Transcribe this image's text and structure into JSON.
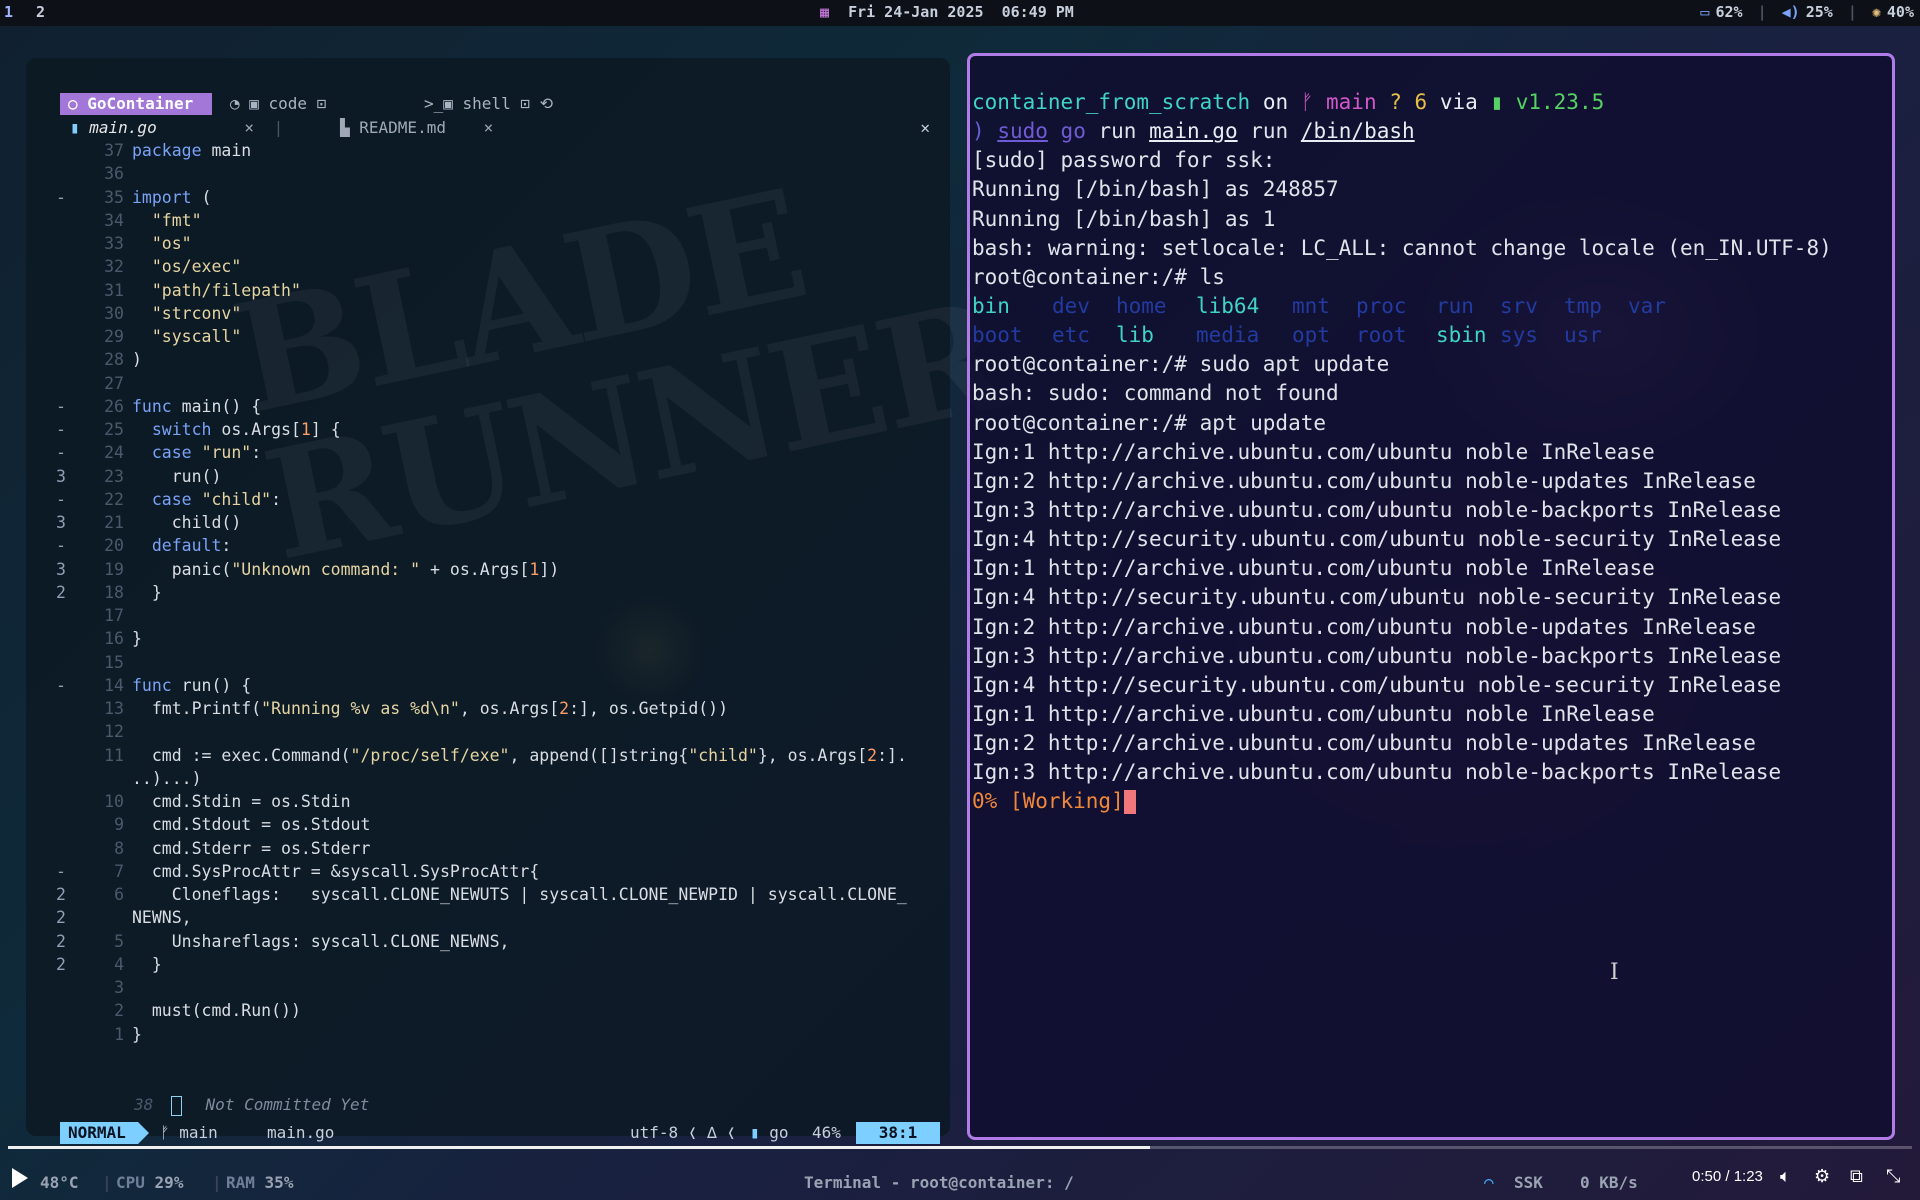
{
  "topbar": {
    "workspace_active": "1",
    "workspace_other": "2",
    "datetime": "Fri 24-Jan 2025  06:49 PM",
    "battery": "62%",
    "volume": "25%",
    "brightness": "40%"
  },
  "editor": {
    "wallpaper_text_1": "BLADE",
    "wallpaper_text_2": "RUNNER",
    "tabs": {
      "active": "GoContainer",
      "code": "code",
      "shell": "shell"
    },
    "buffers": {
      "main": "main.go",
      "readme": "README.md"
    },
    "lines": [
      {
        "sign": "",
        "num": "37",
        "text": "package main"
      },
      {
        "sign": "",
        "num": "36",
        "text": ""
      },
      {
        "sign": "-",
        "num": "35",
        "text": "import ("
      },
      {
        "sign": "",
        "num": "34",
        "text": "  \"fmt\""
      },
      {
        "sign": "",
        "num": "33",
        "text": "  \"os\""
      },
      {
        "sign": "",
        "num": "32",
        "text": "  \"os/exec\""
      },
      {
        "sign": "",
        "num": "31",
        "text": "  \"path/filepath\""
      },
      {
        "sign": "",
        "num": "30",
        "text": "  \"strconv\""
      },
      {
        "sign": "",
        "num": "29",
        "text": "  \"syscall\""
      },
      {
        "sign": "",
        "num": "28",
        "text": ")"
      },
      {
        "sign": "",
        "num": "27",
        "text": ""
      },
      {
        "sign": "-",
        "num": "26",
        "text": "func main() {"
      },
      {
        "sign": "-",
        "num": "25",
        "text": "  switch os.Args[1] {"
      },
      {
        "sign": "-",
        "num": "24",
        "text": "  case \"run\":"
      },
      {
        "sign": "3",
        "num": "23",
        "text": "    run()"
      },
      {
        "sign": "-",
        "num": "22",
        "text": "  case \"child\":"
      },
      {
        "sign": "3",
        "num": "21",
        "text": "    child()"
      },
      {
        "sign": "-",
        "num": "20",
        "text": "  default:"
      },
      {
        "sign": "3",
        "num": "19",
        "text": "    panic(\"Unknown command: \" + os.Args[1])"
      },
      {
        "sign": "2",
        "num": "18",
        "text": "  }"
      },
      {
        "sign": "",
        "num": "17",
        "text": ""
      },
      {
        "sign": "",
        "num": "16",
        "text": "}"
      },
      {
        "sign": "",
        "num": "15",
        "text": ""
      },
      {
        "sign": "-",
        "num": "14",
        "text": "func run() {"
      },
      {
        "sign": "",
        "num": "13",
        "text": "  fmt.Printf(\"Running %v as %d\\n\", os.Args[2:], os.Getpid())"
      },
      {
        "sign": "",
        "num": "12",
        "text": ""
      },
      {
        "sign": "",
        "num": "11",
        "text": "  cmd := exec.Command(\"/proc/self/exe\", append([]string{\"child\"}, os.Args[2:]."
      },
      {
        "sign": "",
        "num": "",
        "text": "..)...)"
      },
      {
        "sign": "",
        "num": "10",
        "text": "  cmd.Stdin = os.Stdin"
      },
      {
        "sign": "",
        "num": "9",
        "text": "  cmd.Stdout = os.Stdout"
      },
      {
        "sign": "",
        "num": "8",
        "text": "  cmd.Stderr = os.Stderr"
      },
      {
        "sign": "-",
        "num": "7",
        "text": "  cmd.SysProcAttr = &syscall.SysProcAttr{"
      },
      {
        "sign": "2",
        "num": "6",
        "text": "    Cloneflags:   syscall.CLONE_NEWUTS | syscall.CLONE_NEWPID | syscall.CLONE_"
      },
      {
        "sign": "2",
        "num": "",
        "text": "NEWNS,"
      },
      {
        "sign": "2",
        "num": "5",
        "text": "    Unshareflags: syscall.CLONE_NEWNS,"
      },
      {
        "sign": "2",
        "num": "4",
        "text": "  }"
      },
      {
        "sign": "",
        "num": "3",
        "text": ""
      },
      {
        "sign": "",
        "num": "2",
        "text": "  must(cmd.Run())"
      },
      {
        "sign": "",
        "num": "1",
        "text": "}"
      }
    ],
    "blame_num": "38",
    "blame_text": "Not Committed Yet",
    "status": {
      "mode": "NORMAL",
      "branch": "main",
      "file": "main.go",
      "encoding": "utf-8",
      "filetype": "go",
      "percent": "46%",
      "position": "38:1"
    }
  },
  "terminal": {
    "prompt": {
      "dir": "container_from_scratch",
      "on": "on",
      "branch": "main",
      "status": "? 6",
      "via": "via",
      "version": "v1.23.5"
    },
    "command": {
      "arrow": ")",
      "sudo": "sudo",
      "go": "go",
      "run": "run",
      "file": "main.go",
      "run2": "run",
      "arg": "/bin/bash"
    },
    "output_lines": [
      "[sudo] password for ssk:",
      "Running [/bin/bash] as 248857",
      "Running [/bin/bash] as 1",
      "bash: warning: setlocale: LC_ALL: cannot change locale (en_IN.UTF-8)",
      "root@container:/# ls"
    ],
    "ls_row1": [
      "bin",
      "dev",
      "home",
      "lib64",
      "mnt",
      "proc",
      "run",
      "srv",
      "tmp",
      "var"
    ],
    "ls_row2": [
      "boot",
      "etc",
      "lib",
      "media",
      "opt",
      "root",
      "sbin",
      "sys",
      "usr"
    ],
    "after_ls": [
      "root@container:/# sudo apt update",
      "bash: sudo: command not found",
      "root@container:/# apt update",
      "Ign:1 http://archive.ubuntu.com/ubuntu noble InRelease",
      "Ign:2 http://archive.ubuntu.com/ubuntu noble-updates InRelease",
      "Ign:3 http://archive.ubuntu.com/ubuntu noble-backports InRelease",
      "Ign:4 http://security.ubuntu.com/ubuntu noble-security InRelease",
      "Ign:1 http://archive.ubuntu.com/ubuntu noble InRelease",
      "Ign:4 http://security.ubuntu.com/ubuntu noble-security InRelease",
      "Ign:2 http://archive.ubuntu.com/ubuntu noble-updates InRelease",
      "Ign:3 http://archive.ubuntu.com/ubuntu noble-backports InRelease",
      "Ign:4 http://security.ubuntu.com/ubuntu noble-security InRelease",
      "Ign:1 http://archive.ubuntu.com/ubuntu noble InRelease",
      "Ign:2 http://archive.ubuntu.com/ubuntu noble-updates InRelease",
      "Ign:3 http://archive.ubuntu.com/ubuntu noble-backports InRelease"
    ],
    "working": "0% [Working]"
  },
  "video": {
    "time": "0:50 / 1:23",
    "progress_fraction": 0.6
  },
  "bottombar": {
    "temp": "48°C",
    "cpu_label": "CPU",
    "cpu": "29%",
    "ram_label": "RAM",
    "ram": "35%",
    "window_title": "Terminal - root@container: /",
    "network": "SSK",
    "speed": "0 KB/s"
  },
  "colors": {
    "accent_purple": "#a277d8",
    "terminal_border": "#b17ce8",
    "mode_cyan": "#7dcfff"
  }
}
